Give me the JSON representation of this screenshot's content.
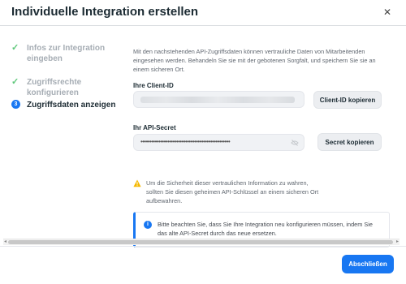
{
  "dialog": {
    "title": "Individuelle Integration erstellen",
    "close_icon": "close-icon"
  },
  "steps": [
    {
      "label": "Infos zur Integration eingeben",
      "status": "done",
      "icon": "check-icon"
    },
    {
      "label": "Zugriffsrechte konfigurieren",
      "status": "done",
      "icon": "check-icon"
    },
    {
      "label": "Zugriffsdaten anzeigen",
      "status": "active",
      "number": "3"
    }
  ],
  "main": {
    "intro": "Mit den nachstehenden API-Zugriffsdaten können vertrauliche Daten von Mitarbeitenden eingesehen werden. Behandeln Sie sie mit der gebotenen Sorgfalt, und speichern Sie sie an einem sicheren Ort.",
    "client_id": {
      "label": "Ihre Client-ID",
      "value": "",
      "copy_label": "Client-ID kopieren"
    },
    "secret": {
      "label": "Ihr API-Secret",
      "masked_value": "••••••••••••••••••••••••••••••••••••••••••••••••••",
      "copy_label": "Secret kopieren",
      "visibility_icon": "eye-off-icon"
    },
    "warning": {
      "icon": "warning-icon",
      "text": "Um die Sicherheit dieser vertraulichen Information zu wahren, sollten Sie diesen geheimen API-Schlüssel an einem sicheren Ort aufbewahren."
    },
    "info": {
      "icon": "info-icon",
      "icon_glyph": "i",
      "text": "Bitte beachten Sie, dass Sie Ihre Integration neu konfigurieren müssen, indem Sie das alte API-Secret durch das neue ersetzen."
    }
  },
  "footer": {
    "close_label": "Abschließen"
  },
  "colors": {
    "primary": "#1877f2",
    "success": "#5fc87b",
    "warning": "#f5b800",
    "muted_text": "#a6adb4"
  }
}
